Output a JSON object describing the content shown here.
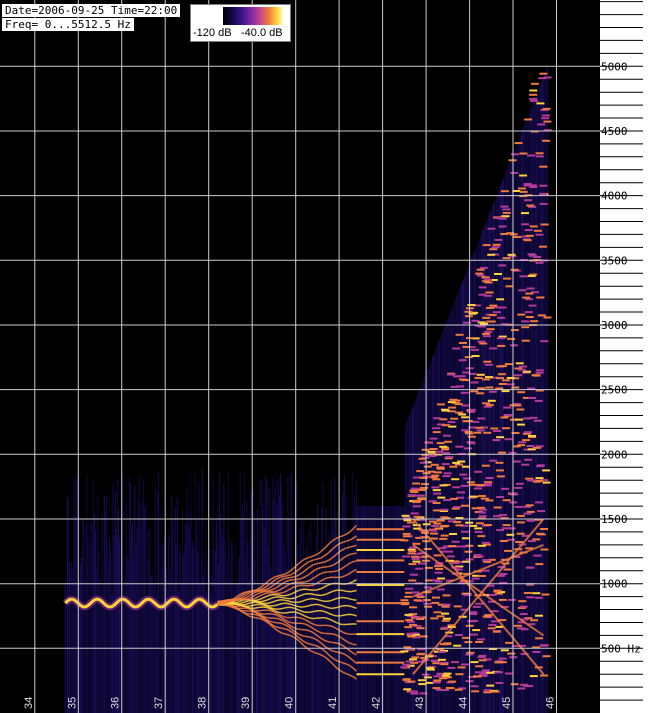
{
  "header": {
    "date_time": "Date=2006-09-25 Time=22:00",
    "freq_range": "Freq= 0...5512.5 Hz"
  },
  "colorbar": {
    "min_label": "-120 dB",
    "max_label": "-40.0 dB",
    "colors": [
      "#000000",
      "#1a0a5c",
      "#5a1fa0",
      "#b43a9a",
      "#f07a3c",
      "#ffd23a",
      "#ffffc8"
    ]
  },
  "chart_data": {
    "type": "heatmap",
    "title": "",
    "xlabel": "",
    "ylabel": "",
    "x_unit": "s",
    "xlim": [
      33.2,
      47.0
    ],
    "ylim": [
      0,
      5512.5
    ],
    "x_ticks": [
      34,
      35,
      36,
      37,
      38,
      39,
      40,
      41,
      42,
      43,
      44,
      45,
      46
    ],
    "y_labeled_ticks": [
      {
        "value": 500,
        "label": "500 Hz"
      },
      {
        "value": 1000,
        "label": "1000"
      },
      {
        "value": 1500,
        "label": "1500"
      },
      {
        "value": 2000,
        "label": "2000"
      },
      {
        "value": 2500,
        "label": "2500"
      },
      {
        "value": 3000,
        "label": "3000"
      },
      {
        "value": 3500,
        "label": "3500"
      },
      {
        "value": 4000,
        "label": "4000"
      },
      {
        "value": 4500,
        "label": "4500"
      },
      {
        "value": 5000,
        "label": "5000"
      }
    ],
    "y_minor_step": 100,
    "grid": true,
    "background_color": "#000000",
    "grid_color": "#cccccc",
    "signal": {
      "fundamental_hz": 850,
      "vibrato_range_s": [
        34.7,
        38.2
      ],
      "vibrato_depth_hz": 30,
      "spread_range_s": [
        38.2,
        41.4
      ],
      "spread_max_hz": 600,
      "steady_range_s": [
        41.4,
        42.5
      ],
      "steady_lines_hz": [
        300,
        390,
        470,
        610,
        710,
        850,
        990,
        1090,
        1180,
        1260,
        1340,
        1420
      ],
      "chaotic_range_s": [
        42.5,
        45.8
      ],
      "chaotic_max_hz": 5200,
      "noise_range_s": [
        34.7,
        45.8
      ]
    }
  }
}
